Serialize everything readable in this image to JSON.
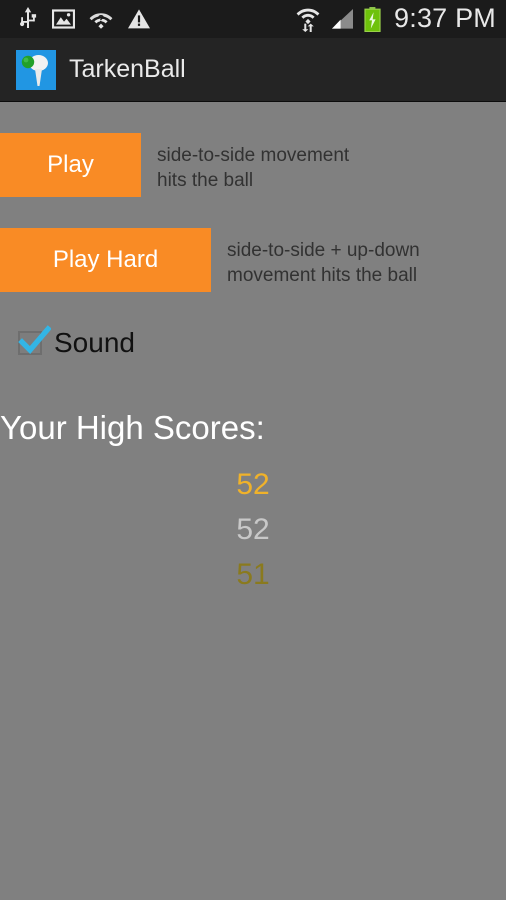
{
  "status_bar": {
    "time": "9:37 PM",
    "left_icons": [
      {
        "name": "usb-icon",
        "label": "USB"
      },
      {
        "name": "screenshot-image-icon",
        "label": "Screenshot"
      },
      {
        "name": "wifi-unknown-icon",
        "label": "Wi-Fi unknown"
      },
      {
        "name": "warning-triangle-icon",
        "label": "Warning"
      }
    ],
    "right_icons": [
      {
        "name": "wifi-transfer-icon",
        "label": "Wi-Fi data transfer"
      },
      {
        "name": "cellular-signal-icon",
        "label": "Cellular signal"
      },
      {
        "name": "battery-charging-icon",
        "label": "Battery charging"
      }
    ]
  },
  "action_bar": {
    "title": "TarkenBall",
    "icon_name": "tarkenball-app-icon"
  },
  "main": {
    "play": {
      "button_label": "Play",
      "hint": "side-to-side movement\nhits the ball"
    },
    "play_hard": {
      "button_label": "Play Hard",
      "hint": "side-to-side + up-down\nmovement hits the ball"
    },
    "sound": {
      "label": "Sound",
      "checked": true
    },
    "high_scores": {
      "title": "Your High Scores:",
      "entries": [
        {
          "value": "52",
          "color": "#f0b22a",
          "rank": "gold"
        },
        {
          "value": "52",
          "color": "#c8c8c8",
          "rank": "silver"
        },
        {
          "value": "51",
          "color": "#8a7a1e",
          "rank": "bronze"
        }
      ]
    }
  },
  "colors": {
    "background": "#808080",
    "accent_orange": "#f98b25",
    "action_bar": "#242424",
    "status_bar": "#1b1b1b",
    "checkbox_accent": "#33b5e5",
    "app_icon_blue": "#2196e3",
    "app_icon_ball_green": "#22a02a"
  }
}
